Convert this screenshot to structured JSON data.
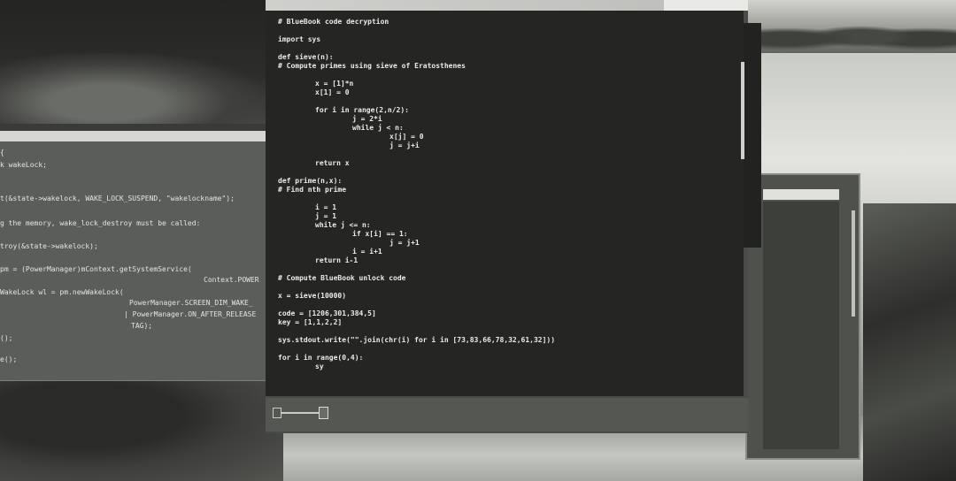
{
  "main_window": {
    "title": "",
    "code_lines": [
      "# BlueBook code decryption",
      "import sys",
      "def sieve(n):",
      "# Compute primes using sieve of Eratosthenes",
      "x = [1]*n",
      "x[1] = 0",
      "for i in range(2,n/2):",
      "j = 2*i",
      "while j < n:",
      "x[j] = 0",
      "j = j+i",
      "return x",
      "def prime(n,x):",
      "# Find nth prime",
      "i = 1",
      "j = 1",
      "while j <= n:",
      "if x[i] == 1:",
      "j = j+1",
      "i = i+1",
      "return i-1",
      "# Compute BlueBook unlock code",
      "x = sieve(10000)",
      "code = [1206,301,384,5]",
      "key = [1,1,2,2]",
      "sys.stdout.write(\"\".join(chr(i) for i in [73,83,66,78,32,61,32]))",
      "for i in range(0,4):",
      "sy"
    ]
  },
  "left_window": {
    "code_lines": [
      "{",
      "k wakeLock;",
      "t(&state->wakelock, WAKE_LOCK_SUSPEND, \"wakelockname\");",
      "g the memory, wake_lock_destroy must be called:",
      "troy(&state->wakelock);",
      "pm = (PowerManager)mContext.getSystemService(",
      "Context.POWER",
      "WakeLock wl = pm.newWakeLock(",
      "PowerManager.SCREEN_DIM_WAKE_",
      "| PowerManager.ON_AFTER_RELEASE",
      "TAG);",
      "();",
      "e();"
    ]
  }
}
